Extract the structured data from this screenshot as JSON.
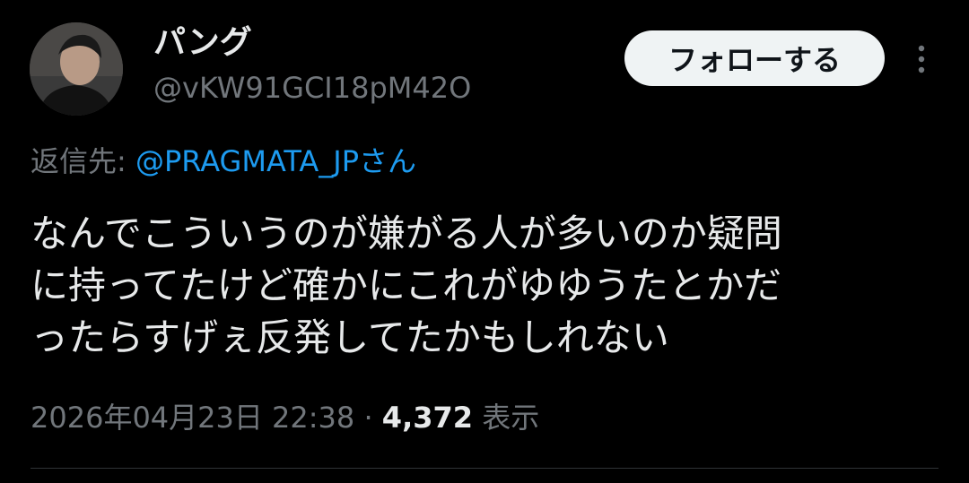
{
  "author": {
    "display_name": "パング",
    "handle": "@vKW91GCI18pM42O"
  },
  "actions": {
    "follow_label": "フォローする",
    "more_icon": "more-vertical-icon"
  },
  "reply": {
    "prefix": "返信先: ",
    "mention": "@PRAGMATA_JPさん"
  },
  "tweet": {
    "lines": [
      "なんでこういうのが嫌がる人が多いのか疑問",
      "に持ってたけど確かにこれがゆゆうたとかだ",
      "ったらすげぇ反発してたかもしれない"
    ]
  },
  "meta": {
    "timestamp": "2026年04月23日 22:38",
    "separator": " · ",
    "views_count": "4,372",
    "views_label": " 表示"
  },
  "colors": {
    "background": "#000000",
    "text_primary": "#e7e9ea",
    "text_secondary": "#71767b",
    "link": "#1d9bf0",
    "follow_bg": "#eff3f4",
    "divider": "#2f3336"
  }
}
